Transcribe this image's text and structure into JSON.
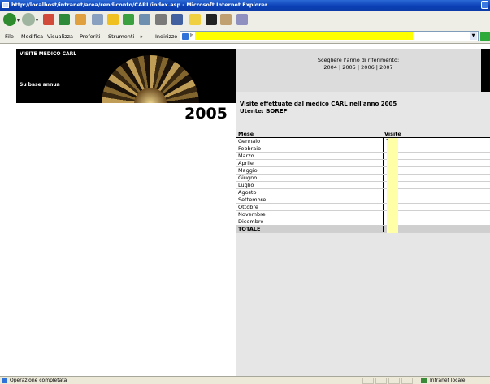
{
  "window": {
    "title": "http://localhost/intranet/area/rendiconto/CARL/index.asp - Microsoft Internet Explorer"
  },
  "menubar": {
    "items": [
      "File",
      "Modifica",
      "Visualizza",
      "Preferiti",
      "Strumenti"
    ],
    "overflow": "»",
    "address_label": "Indirizzo",
    "address_value": "h"
  },
  "banner": {
    "title": "VISITE MEDICO CARL",
    "subtitle": "Su base annua"
  },
  "year_display": "2005",
  "year_select": {
    "label": "Scegliere l'anno di riferimento:",
    "years": [
      "2004",
      "2005",
      "2006",
      "2007"
    ],
    "separator": "|"
  },
  "report": {
    "heading": "Visite effettuate dal medico CARL nell'anno 2005",
    "user": "Utente: BOREP",
    "columns": [
      "Mese",
      "Visite"
    ],
    "rows": [
      {
        "month": "Gennaio",
        "visits": "^"
      },
      {
        "month": "Febbraio",
        "visits": ""
      },
      {
        "month": "Marzo",
        "visits": ""
      },
      {
        "month": "Aprile",
        "visits": ""
      },
      {
        "month": "Maggio",
        "visits": ""
      },
      {
        "month": "Giugno",
        "visits": ""
      },
      {
        "month": "Luglio",
        "visits": ""
      },
      {
        "month": "Agosto",
        "visits": ""
      },
      {
        "month": "Settembre",
        "visits": ""
      },
      {
        "month": "Ottobre",
        "visits": ""
      },
      {
        "month": "Novembre",
        "visits": ""
      },
      {
        "month": "Dicembre",
        "visits": ""
      }
    ],
    "total_label": "TOTALE",
    "total_value": ""
  },
  "statusbar": {
    "text": "Operazione completata",
    "zone": "Intranet locale"
  }
}
